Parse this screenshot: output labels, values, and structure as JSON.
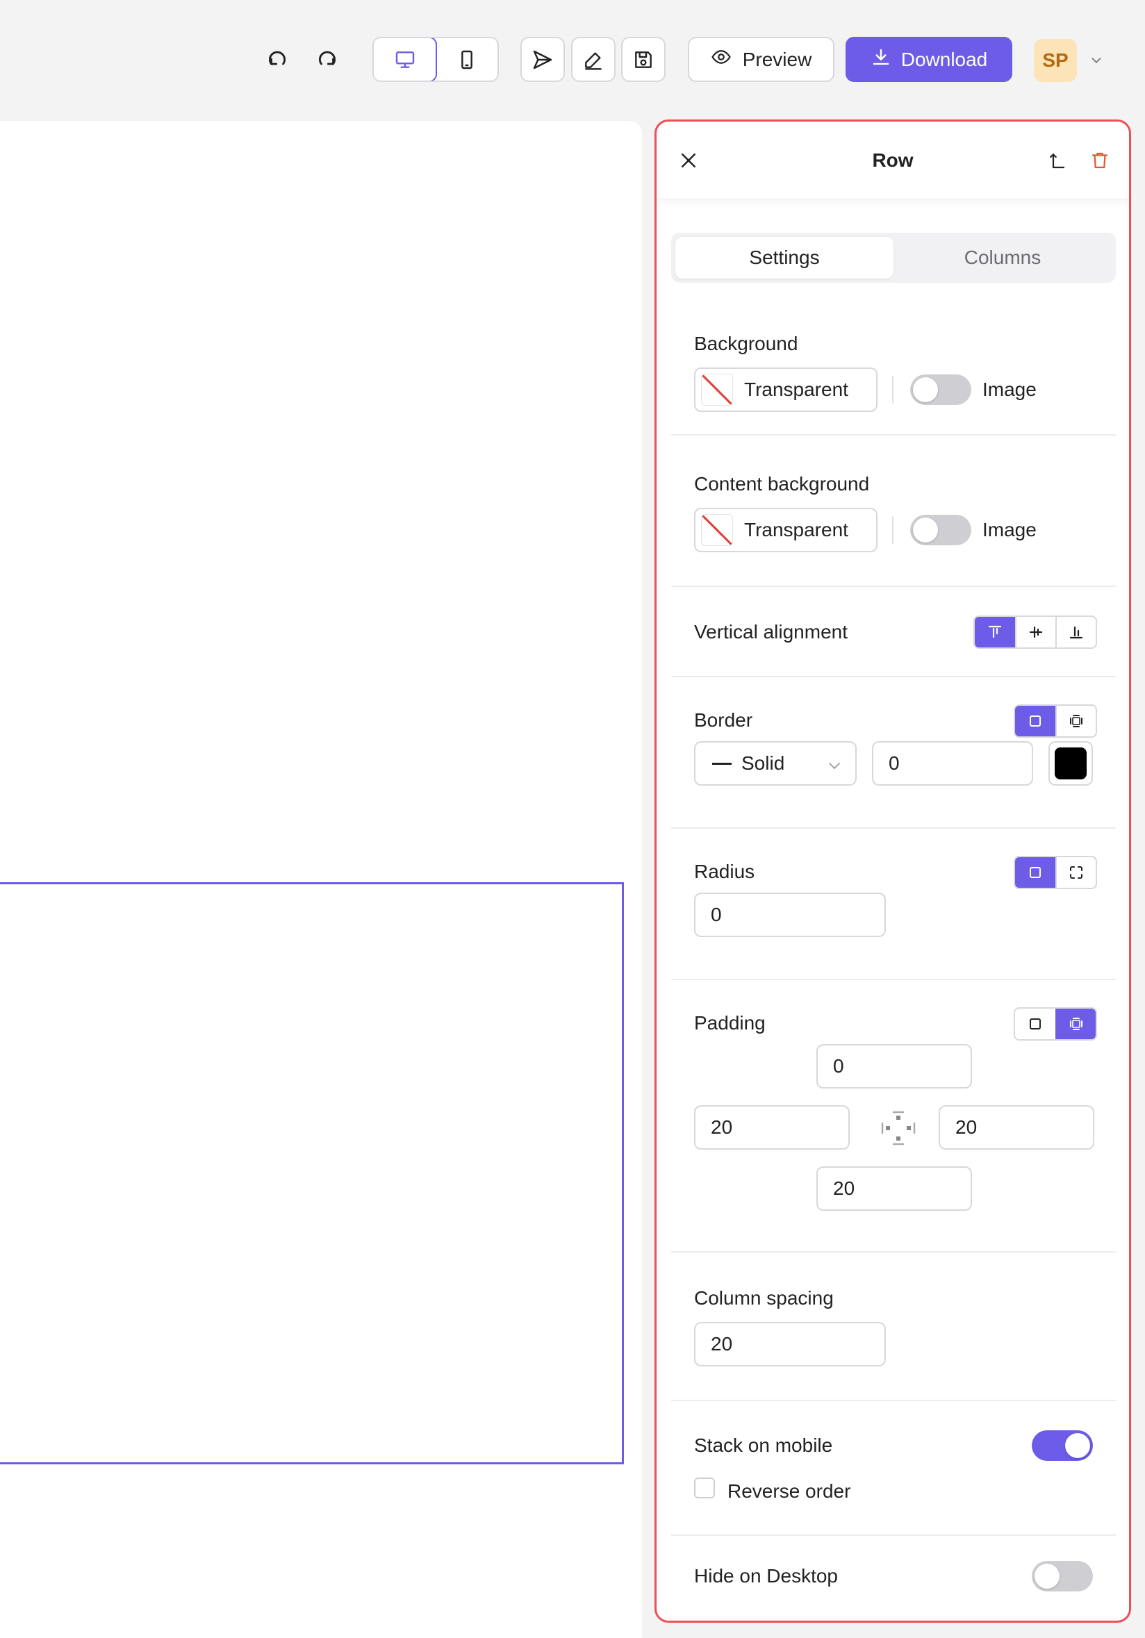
{
  "toolbar": {
    "undo_icon": "undo-icon",
    "redo_icon": "redo-icon",
    "device_desktop_icon": "monitor-icon",
    "device_mobile_icon": "phone-icon",
    "send_icon": "send-icon",
    "edit_icon": "pencil-icon",
    "save_icon": "save-icon",
    "preview_label": "Preview",
    "download_label": "Download",
    "avatar_initials": "SP",
    "accent_color": "#6c5ce7"
  },
  "panel": {
    "title": "Row",
    "tabs": [
      {
        "label": "Settings",
        "active": true
      },
      {
        "label": "Columns",
        "active": false
      }
    ],
    "background": {
      "label": "Background",
      "color_value": "Transparent",
      "image_label": "Image",
      "image_enabled": false
    },
    "content_background": {
      "label": "Content background",
      "color_value": "Transparent",
      "image_label": "Image",
      "image_enabled": false
    },
    "vertical_alignment": {
      "label": "Vertical alignment",
      "selected": "top"
    },
    "border": {
      "label": "Border",
      "style": "Solid",
      "width": "0",
      "color": "#000000"
    },
    "radius": {
      "label": "Radius",
      "value": "0"
    },
    "padding": {
      "label": "Padding",
      "top": "0",
      "left": "20",
      "right": "20",
      "bottom": "20"
    },
    "column_spacing": {
      "label": "Column spacing",
      "value": "20"
    },
    "stack_on_mobile": {
      "label": "Stack on mobile",
      "enabled": true,
      "reverse_label": "Reverse order",
      "reverse_checked": false
    },
    "hide_on_desktop": {
      "label": "Hide on Desktop",
      "enabled": false
    }
  }
}
